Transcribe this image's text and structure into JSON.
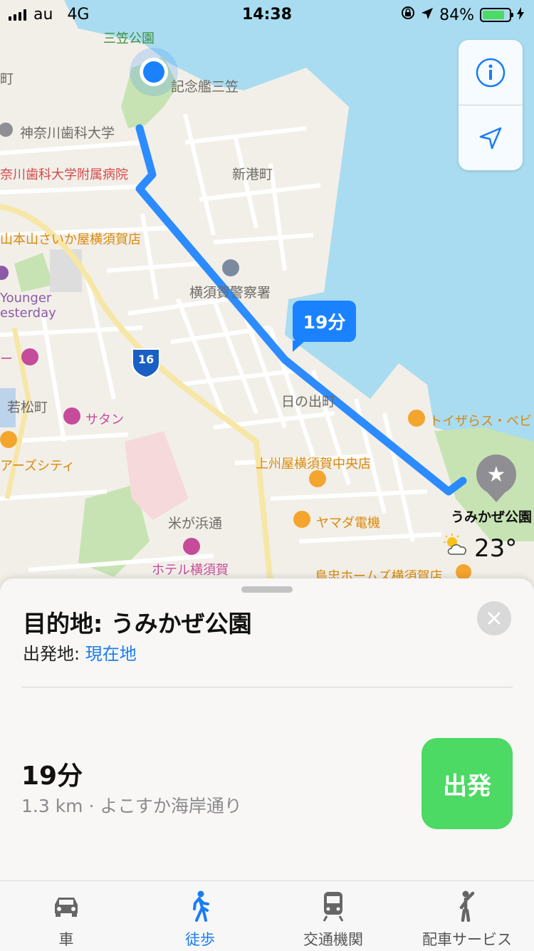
{
  "status_bar": {
    "carrier": "au",
    "network": "4G",
    "time": "14:38",
    "battery_percent": "84%",
    "battery_level": 0.84
  },
  "map": {
    "labels": {
      "mikasa_park": "三笠公園",
      "kinenkan_mikasa": "記念艦三笠",
      "kanagawa_dental": "神奈川歯科大学",
      "kanagawa_dental_hospital": "奈川歯科大学附属病院",
      "shinko_cho": "新港町",
      "sanbonyama": "山本山さいか屋横須賀店",
      "younger_1": "Younger",
      "younger_2": "esterday",
      "police": "横須賀警察署",
      "route_16": "16",
      "hinode_cho": "日の出町",
      "wakamatsu_cho": "若松町",
      "satan": "サタン",
      "ders_city": "アーズシティ",
      "toysrus": "トイザらス・ベビ",
      "jyoshuya": "上州屋横須賀中央店",
      "yamada": "ヤマダ電機",
      "umikaze_park": "うみかぜ公園",
      "yonegahama": "米が浜通",
      "hotel": "ホテル横須賀",
      "shimachu": "島忠ホームズ横須賀店",
      "machi_left": "町",
      "bar_left": "ー"
    },
    "route_bubble": "19分",
    "temperature": "23°",
    "colors": {
      "water": "#a9dcf0",
      "land": "#f2efe9",
      "park": "#c7e3b3",
      "route": "#1b82ff",
      "road_major": "#f6e7a6"
    }
  },
  "sheet": {
    "destination": "目的地: うみかぜ公園",
    "origin_label": "出発地: ",
    "origin_value": "現在地",
    "duration": "19分",
    "details": "1.3 km · よこすか海岸通り",
    "go_button": "出発"
  },
  "tabs": [
    {
      "label": "車",
      "icon": "car-icon",
      "active": false
    },
    {
      "label": "徒歩",
      "icon": "walk-icon",
      "active": true
    },
    {
      "label": "交通機関",
      "icon": "train-icon",
      "active": false
    },
    {
      "label": "配車サービス",
      "icon": "ride-icon",
      "active": false
    }
  ]
}
